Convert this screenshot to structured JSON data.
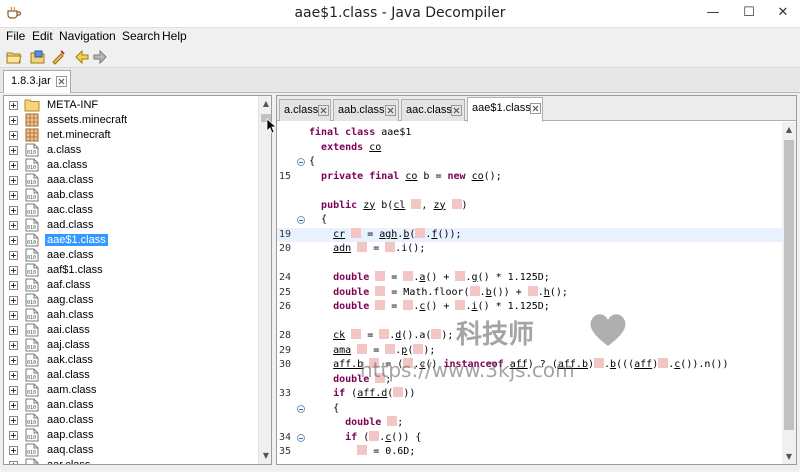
{
  "window": {
    "title": "aae$1.class - Java Decompiler",
    "minimize": "—",
    "maximize": "☐",
    "close": "✕"
  },
  "menu": [
    "File",
    "Edit",
    "Navigation",
    "Search",
    "Help"
  ],
  "toolbar": [
    "open-file-icon",
    "open-folder-icon",
    "clear-history-icon",
    "back-arrow-icon",
    "forward-arrow-icon"
  ],
  "file_tab": {
    "label": "1.8.3.jar"
  },
  "tree": {
    "selected": "aae$1.class",
    "items": [
      {
        "label": "META-INF",
        "icon": "folder-icon"
      },
      {
        "label": "assets.minecraft",
        "icon": "package-icon"
      },
      {
        "label": "net.minecraft",
        "icon": "package-icon"
      },
      {
        "label": "a.class",
        "icon": "class-file-icon"
      },
      {
        "label": "aa.class",
        "icon": "class-file-icon"
      },
      {
        "label": "aaa.class",
        "icon": "class-file-icon"
      },
      {
        "label": "aab.class",
        "icon": "class-file-icon"
      },
      {
        "label": "aac.class",
        "icon": "class-file-icon"
      },
      {
        "label": "aad.class",
        "icon": "class-file-icon"
      },
      {
        "label": "aae$1.class",
        "icon": "class-file-icon"
      },
      {
        "label": "aae.class",
        "icon": "class-file-icon"
      },
      {
        "label": "aaf$1.class",
        "icon": "class-file-icon"
      },
      {
        "label": "aaf.class",
        "icon": "class-file-icon"
      },
      {
        "label": "aag.class",
        "icon": "class-file-icon"
      },
      {
        "label": "aah.class",
        "icon": "class-file-icon"
      },
      {
        "label": "aai.class",
        "icon": "class-file-icon"
      },
      {
        "label": "aaj.class",
        "icon": "class-file-icon"
      },
      {
        "label": "aak.class",
        "icon": "class-file-icon"
      },
      {
        "label": "aal.class",
        "icon": "class-file-icon"
      },
      {
        "label": "aam.class",
        "icon": "class-file-icon"
      },
      {
        "label": "aan.class",
        "icon": "class-file-icon"
      },
      {
        "label": "aao.class",
        "icon": "class-file-icon"
      },
      {
        "label": "aap.class",
        "icon": "class-file-icon"
      },
      {
        "label": "aaq.class",
        "icon": "class-file-icon"
      },
      {
        "label": "aar.class",
        "icon": "class-file-icon"
      }
    ]
  },
  "editor_tabs": [
    {
      "label": "a.class"
    },
    {
      "label": "aab.class"
    },
    {
      "label": "aac.class"
    },
    {
      "label": "aae$1.class",
      "active": true
    }
  ],
  "code": {
    "placeholder_glyph": "obfuscated-identifier-glyph",
    "lines": [
      {
        "no": "",
        "text": "@kfinal class@ aae$1"
      },
      {
        "no": "",
        "text": "  @kextends@ _co_"
      },
      {
        "no": "",
        "text": "{",
        "fold": true
      },
      {
        "no": "15",
        "text": "  @kprivate final@ _co_ b = @knew@ _co_();"
      },
      {
        "no": "",
        "text": ""
      },
      {
        "no": "",
        "text": "  @kpublic@ _zy_ b(_cl_ #, _zy_ #)"
      },
      {
        "no": "",
        "text": "  {",
        "fold": true
      },
      {
        "no": "19",
        "text": "    _cr_ # = _agh_._b_(#._f_());",
        "current": true
      },
      {
        "no": "20",
        "text": "    _adn_ # = #.i();"
      },
      {
        "no": "",
        "text": ""
      },
      {
        "no": "24",
        "text": "    @kdouble@ # = #._a_() + #._g_() * 1.125D;"
      },
      {
        "no": "25",
        "text": "    @kdouble@ # = Math.floor(#._b_()) + #._h_();"
      },
      {
        "no": "26",
        "text": "    @kdouble@ # = #._c_() + #._i_() * 1.125D;"
      },
      {
        "no": "",
        "text": ""
      },
      {
        "no": "28",
        "text": "    _ck_ # = #._d_().a(#);"
      },
      {
        "no": "29",
        "text": "    _ama_ # = #._p_(#);"
      },
      {
        "no": "30",
        "text": "    _aff.b_ # = (#._c_() @kinstanceof@ _aff_) ? (_aff.b_)#._b_(((_aff_)#._c_()).n())"
      },
      {
        "no": "",
        "text": "    @kdouble@ #;"
      },
      {
        "no": "33",
        "text": "    @kif@ (_aff.d_(#))"
      },
      {
        "no": "",
        "text": "    {",
        "fold": true
      },
      {
        "no": "",
        "text": "      @kdouble@ #;"
      },
      {
        "no": "34",
        "text": "      @kif@ (#._c_()) {",
        "fold": true
      },
      {
        "no": "35",
        "text": "        # = 0.6D;"
      }
    ]
  },
  "watermark": {
    "title": "科技师",
    "url": "https://www.3kjs.com"
  }
}
